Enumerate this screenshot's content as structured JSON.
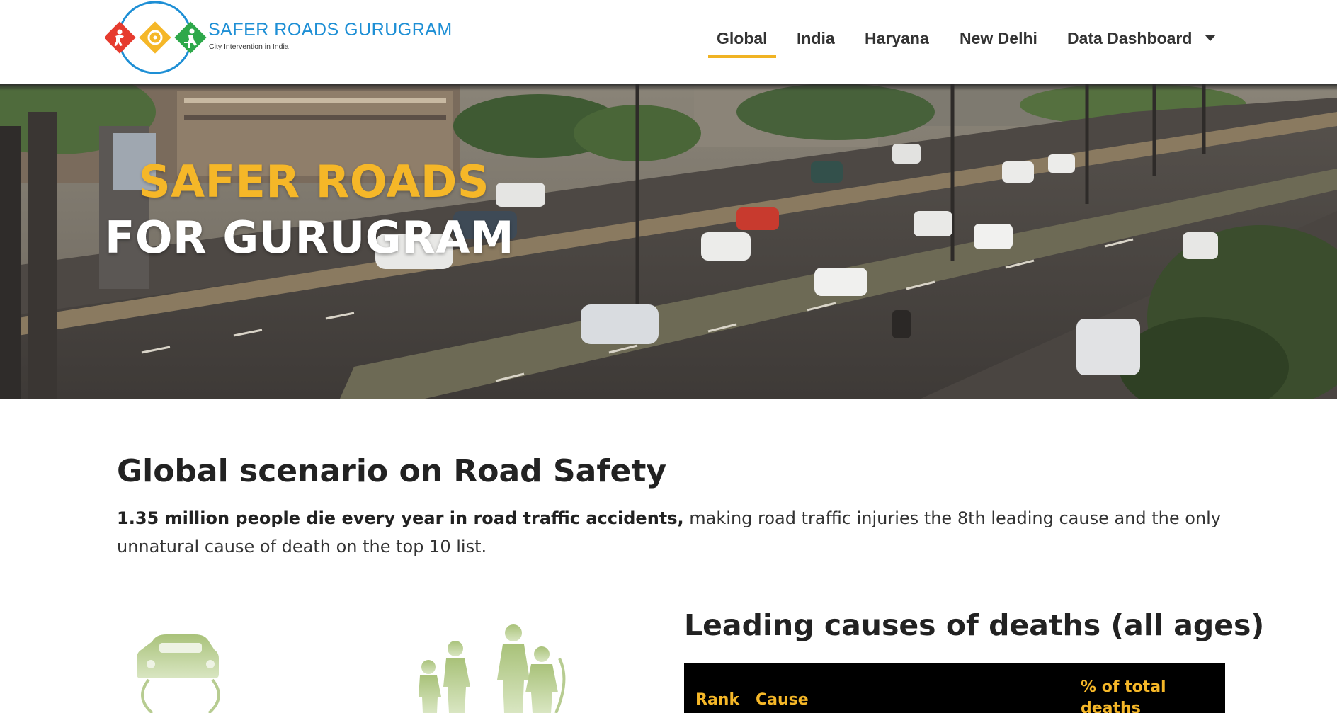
{
  "brand": {
    "title": "SAFER ROADS GURUGRAM",
    "subtitle": "City Intervention in India"
  },
  "nav": {
    "items": [
      {
        "label": "Global",
        "active": true
      },
      {
        "label": "India",
        "active": false
      },
      {
        "label": "Haryana",
        "active": false
      },
      {
        "label": "New Delhi",
        "active": false
      },
      {
        "label": "Data Dashboard",
        "active": false,
        "has_dropdown": true
      }
    ]
  },
  "hero": {
    "line1": "SAFER ROADS",
    "line2": "FOR GURUGRAM",
    "image": "highway-traffic-photo"
  },
  "main": {
    "heading": "Global scenario on Road Safety",
    "intro_bold": "1.35 million people die every year in road traffic accidents,",
    "intro_rest": " making road traffic injuries the 8th leading cause and the only unnatural cause of death on the top 10 list.",
    "illustration": "car-and-pedestrians-illustration"
  },
  "causes": {
    "title": "Leading causes of deaths (all ages)",
    "columns": [
      "Rank",
      "Cause",
      "% of total deaths"
    ]
  },
  "colors": {
    "accent": "#f0b323",
    "brand_blue": "#1e8fd5",
    "hero_white": "#ffffff",
    "table_bg": "#000000",
    "table_header": "#f5b728"
  }
}
